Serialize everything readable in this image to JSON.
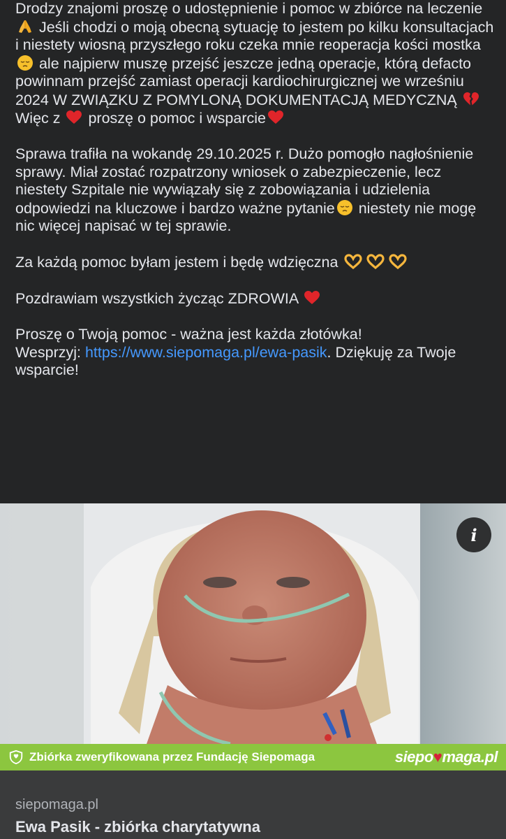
{
  "post": {
    "p1_a": "Drodzy znajomi proszę o udostępnienie i pomoc w zbiórce na leczenie",
    "p1_b": " Jeśli chodzi o moją obecną sytuację to jestem po kilku konsultacjach i niestety wiosną przyszłego roku czeka mnie reoperacja kości mostka",
    "p1_c": " ale najpierw muszę przejść jeszcze jedną operacje, którą defacto powinnam przejść zamiast operacji kardiochirurgicznej we wrześniu 2024 W ZWIĄZKU Z POMYLONĄ DOKUMENTACJĄ MEDYCZNĄ",
    "p1_d": "Więc z",
    "p1_e": " proszę o pomoc i wsparcie",
    "p2_a": "Sprawa trafiła na wokandę 29.10.2025 r. Dużo pomogło nagłośnienie sprawy. Miał zostać rozpatrzony wniosek o zabezpieczenie, lecz niestety Szpitale nie wywiązały się z zobowiązania i udzielenia odpowiedzi na kluczowe i bardzo ważne pytanie",
    "p2_b": " niestety nie mogę nic więcej napisać w tej sprawie.",
    "p3": "Za każdą pomoc byłam jestem i będę wdzięczna ",
    "p4": "Pozdrawiam wszystkich życząc ZDROWIA ",
    "p5_a": "Proszę o Twoją pomoc - ważna jest każda złotówka!",
    "p5_b": "Wesprzyj: ",
    "p5_link": "https://www.siepomaga.pl/ewa-pasik",
    "p5_c": ". Dziękuję za Twoje wsparcie!"
  },
  "preview": {
    "verify_text": "Zbiórka zweryfikowana przez Fundację Siepomaga",
    "logo_a": "siepo",
    "logo_b": "maga.pl",
    "domain": "siepomaga.pl",
    "title": "Ewa Pasik - zbiórka charytatywna",
    "info_label": "i"
  },
  "colors": {
    "background": "#242526",
    "text": "#e4e6eb",
    "link": "#4599ff",
    "verify_bar": "#8cc63f",
    "card_meta": "#3a3b3c"
  },
  "icons": [
    "pray-emoji-icon",
    "pensive-emoji-icon",
    "broken-heart-emoji-icon",
    "red-heart-emoji-icon",
    "heart-hands-emoji-icon",
    "info-icon",
    "verified-shield-icon"
  ]
}
